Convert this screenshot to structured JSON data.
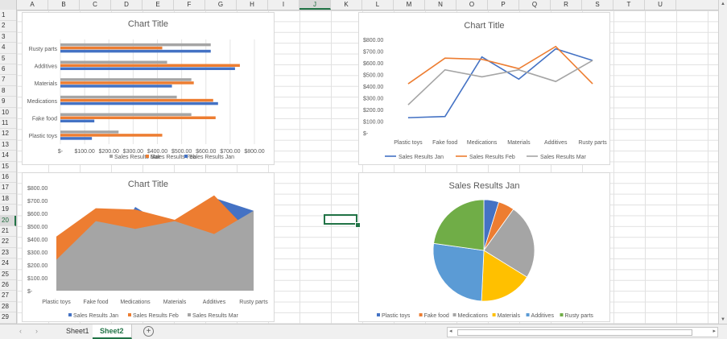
{
  "sheet": {
    "columns": [
      "A",
      "B",
      "C",
      "D",
      "E",
      "F",
      "G",
      "H",
      "I",
      "J",
      "K",
      "L",
      "M",
      "N",
      "O",
      "P",
      "Q",
      "R",
      "S",
      "T",
      "U"
    ],
    "selected_column": "J",
    "rows": [
      "1",
      "2",
      "3",
      "4",
      "5",
      "6",
      "7",
      "8",
      "9",
      "10",
      "11",
      "12",
      "13",
      "14",
      "15",
      "16",
      "17",
      "18",
      "19",
      "20",
      "21",
      "22",
      "23",
      "24",
      "25",
      "26",
      "27",
      "28",
      "29"
    ],
    "selected_row": "20",
    "tabs": [
      {
        "label": "Sheet1"
      },
      {
        "label": "Sheet2"
      }
    ],
    "active_tab": "Sheet2",
    "add_sheet": "+"
  },
  "colors": {
    "jan": "#4472c4",
    "feb": "#ed7d31",
    "mar": "#a5a5a5",
    "materials": "#ffc000",
    "additives": "#5b9bd5",
    "rusty": "#70ad47",
    "excel_green": "#217346"
  },
  "chart_data": [
    {
      "type": "bar",
      "orientation": "horizontal",
      "title": "Chart Title",
      "categories": [
        "Plastic toys",
        "Fake food",
        "Medications",
        "Materials",
        "Additives",
        "Rusty parts"
      ],
      "series": [
        {
          "name": "Sales Results  Jan",
          "values": [
            130,
            140,
            650,
            460,
            720,
            620
          ]
        },
        {
          "name": "Sales Results  Feb",
          "values": [
            420,
            640,
            630,
            550,
            740,
            420
          ]
        },
        {
          "name": "Sales Results  Mar",
          "values": [
            240,
            540,
            480,
            540,
            440,
            620
          ]
        }
      ],
      "xlim": [
        0,
        800
      ],
      "x_ticks": [
        "$-",
        "$100.00",
        "$200.00",
        "$300.00",
        "$400.00",
        "$500.00",
        "$600.00",
        "$700.00",
        "$800.00"
      ],
      "legend": "bottom"
    },
    {
      "type": "line",
      "title": "Chart Title",
      "categories": [
        "Plastic toys",
        "Fake food",
        "Medications",
        "Materials",
        "Additives",
        "Rusty parts"
      ],
      "series": [
        {
          "name": "Sales Results  Jan",
          "values": [
            130,
            140,
            650,
            460,
            720,
            620
          ]
        },
        {
          "name": "Sales Results  Feb",
          "values": [
            420,
            640,
            630,
            550,
            740,
            420
          ]
        },
        {
          "name": "Sales Results  Mar",
          "values": [
            240,
            540,
            480,
            540,
            440,
            620
          ]
        }
      ],
      "ylim": [
        0,
        800
      ],
      "y_ticks": [
        "$-",
        "$100.00",
        "$200.00",
        "$300.00",
        "$400.00",
        "$500.00",
        "$600.00",
        "$700.00",
        "$800.00"
      ],
      "legend": "bottom"
    },
    {
      "type": "area",
      "title": "Chart Title",
      "categories": [
        "Plastic toys",
        "Fake food",
        "Medications",
        "Materials",
        "Additives",
        "Rusty parts"
      ],
      "series": [
        {
          "name": "Sales Results  Jan",
          "values": [
            130,
            140,
            650,
            460,
            720,
            620
          ]
        },
        {
          "name": "Sales Results  Feb",
          "values": [
            420,
            640,
            630,
            550,
            740,
            420
          ]
        },
        {
          "name": "Sales Results  Mar",
          "values": [
            240,
            540,
            480,
            540,
            440,
            620
          ]
        }
      ],
      "ylim": [
        0,
        800
      ],
      "y_ticks": [
        "$-",
        "$100.00",
        "$200.00",
        "$300.00",
        "$400.00",
        "$500.00",
        "$600.00",
        "$700.00",
        "$800.00"
      ],
      "legend": "bottom"
    },
    {
      "type": "pie",
      "title": "Sales Results  Jan",
      "categories": [
        "Plastic toys",
        "Fake food",
        "Medications",
        "Materials",
        "Additives",
        "Rusty parts"
      ],
      "values": [
        130,
        140,
        650,
        460,
        720,
        620
      ],
      "legend": "bottom"
    }
  ]
}
